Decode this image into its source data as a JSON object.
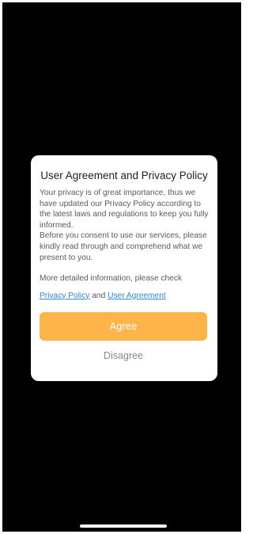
{
  "dialog": {
    "title": "User Agreement and Privacy Policy",
    "body_paragraph_1": "Your privacy is of great importance, thus we have updated our Privacy Policy according to the latest laws and regulations to keep you fully informed.",
    "body_paragraph_2": "Before you consent to use our services, please kindly read through and comprehend what we present to you.",
    "more_info": "More detailed information, please check",
    "privacy_policy_link": "Privacy Policy",
    "and_text": "and",
    "user_agreement_link": "User Agreement",
    "agree_label": "Agree",
    "disagree_label": "Disagree"
  },
  "colors": {
    "background": "#000000",
    "dialog_background": "#ffffff",
    "agree_button": "#fdb54a",
    "link": "#2f86d8",
    "disagree_text": "#8a8a8a"
  }
}
